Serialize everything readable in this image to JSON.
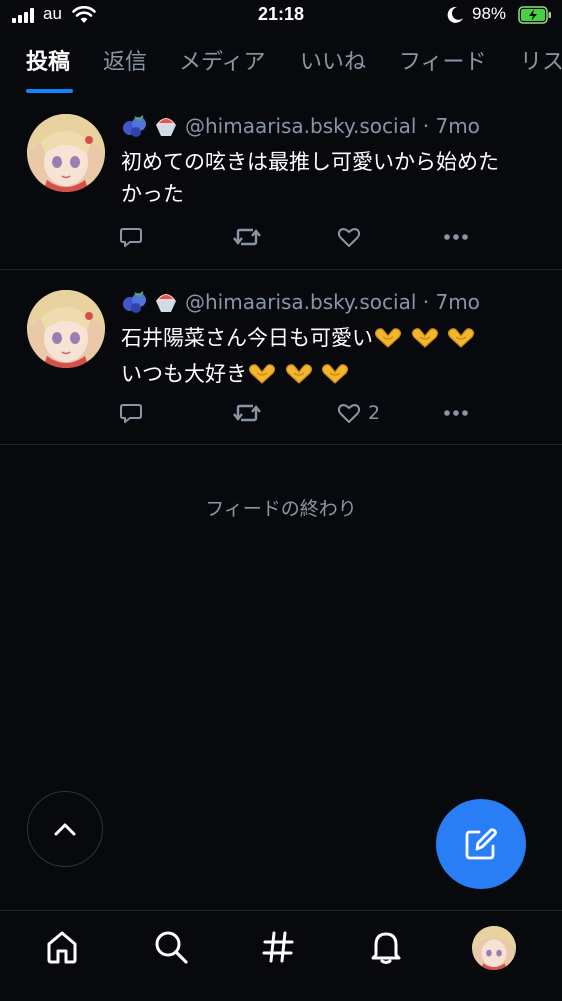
{
  "status_bar": {
    "carrier": "au",
    "time": "21:18",
    "battery_percent": "98%",
    "signal_bars": 4,
    "icons": [
      "signal-icon",
      "wifi-icon",
      "moon-icon",
      "battery-charging-icon"
    ]
  },
  "tabs": [
    {
      "label": "投稿",
      "active": true
    },
    {
      "label": "返信",
      "active": false
    },
    {
      "label": "メディア",
      "active": false
    },
    {
      "label": "いいね",
      "active": false
    },
    {
      "label": "フィード",
      "active": false
    },
    {
      "label": "リスト",
      "active": false
    }
  ],
  "posts": [
    {
      "handle": "@himaarisa.bsky.social",
      "time": "7mo",
      "emoji_icons": [
        "blueberries-icon",
        "shaved-ice-icon"
      ],
      "text_lines": [
        "初めての呟きは最推し可愛いから始めた",
        "かった"
      ],
      "like_count": ""
    },
    {
      "handle": "@himaarisa.bsky.social",
      "time": "7mo",
      "emoji_icons": [
        "blueberries-icon",
        "shaved-ice-icon"
      ],
      "text_lines": [
        "石井陽菜さん今日も可愛い",
        "いつも大好き"
      ],
      "line_emoji": [
        "heart-hands-icon",
        "heart-hands-icon",
        "heart-hands-icon"
      ],
      "like_count": "2"
    }
  ],
  "feed_end": "フィードの終わり",
  "bottom_nav": [
    "home-icon",
    "search-icon",
    "hashtag-icon",
    "bell-icon",
    "profile-avatar"
  ],
  "colors": {
    "background": "#07090d",
    "accent": "#1083fe",
    "compose_button": "#2a7ef5",
    "muted_text": "#8a95a6",
    "divider": "#1f2631"
  }
}
